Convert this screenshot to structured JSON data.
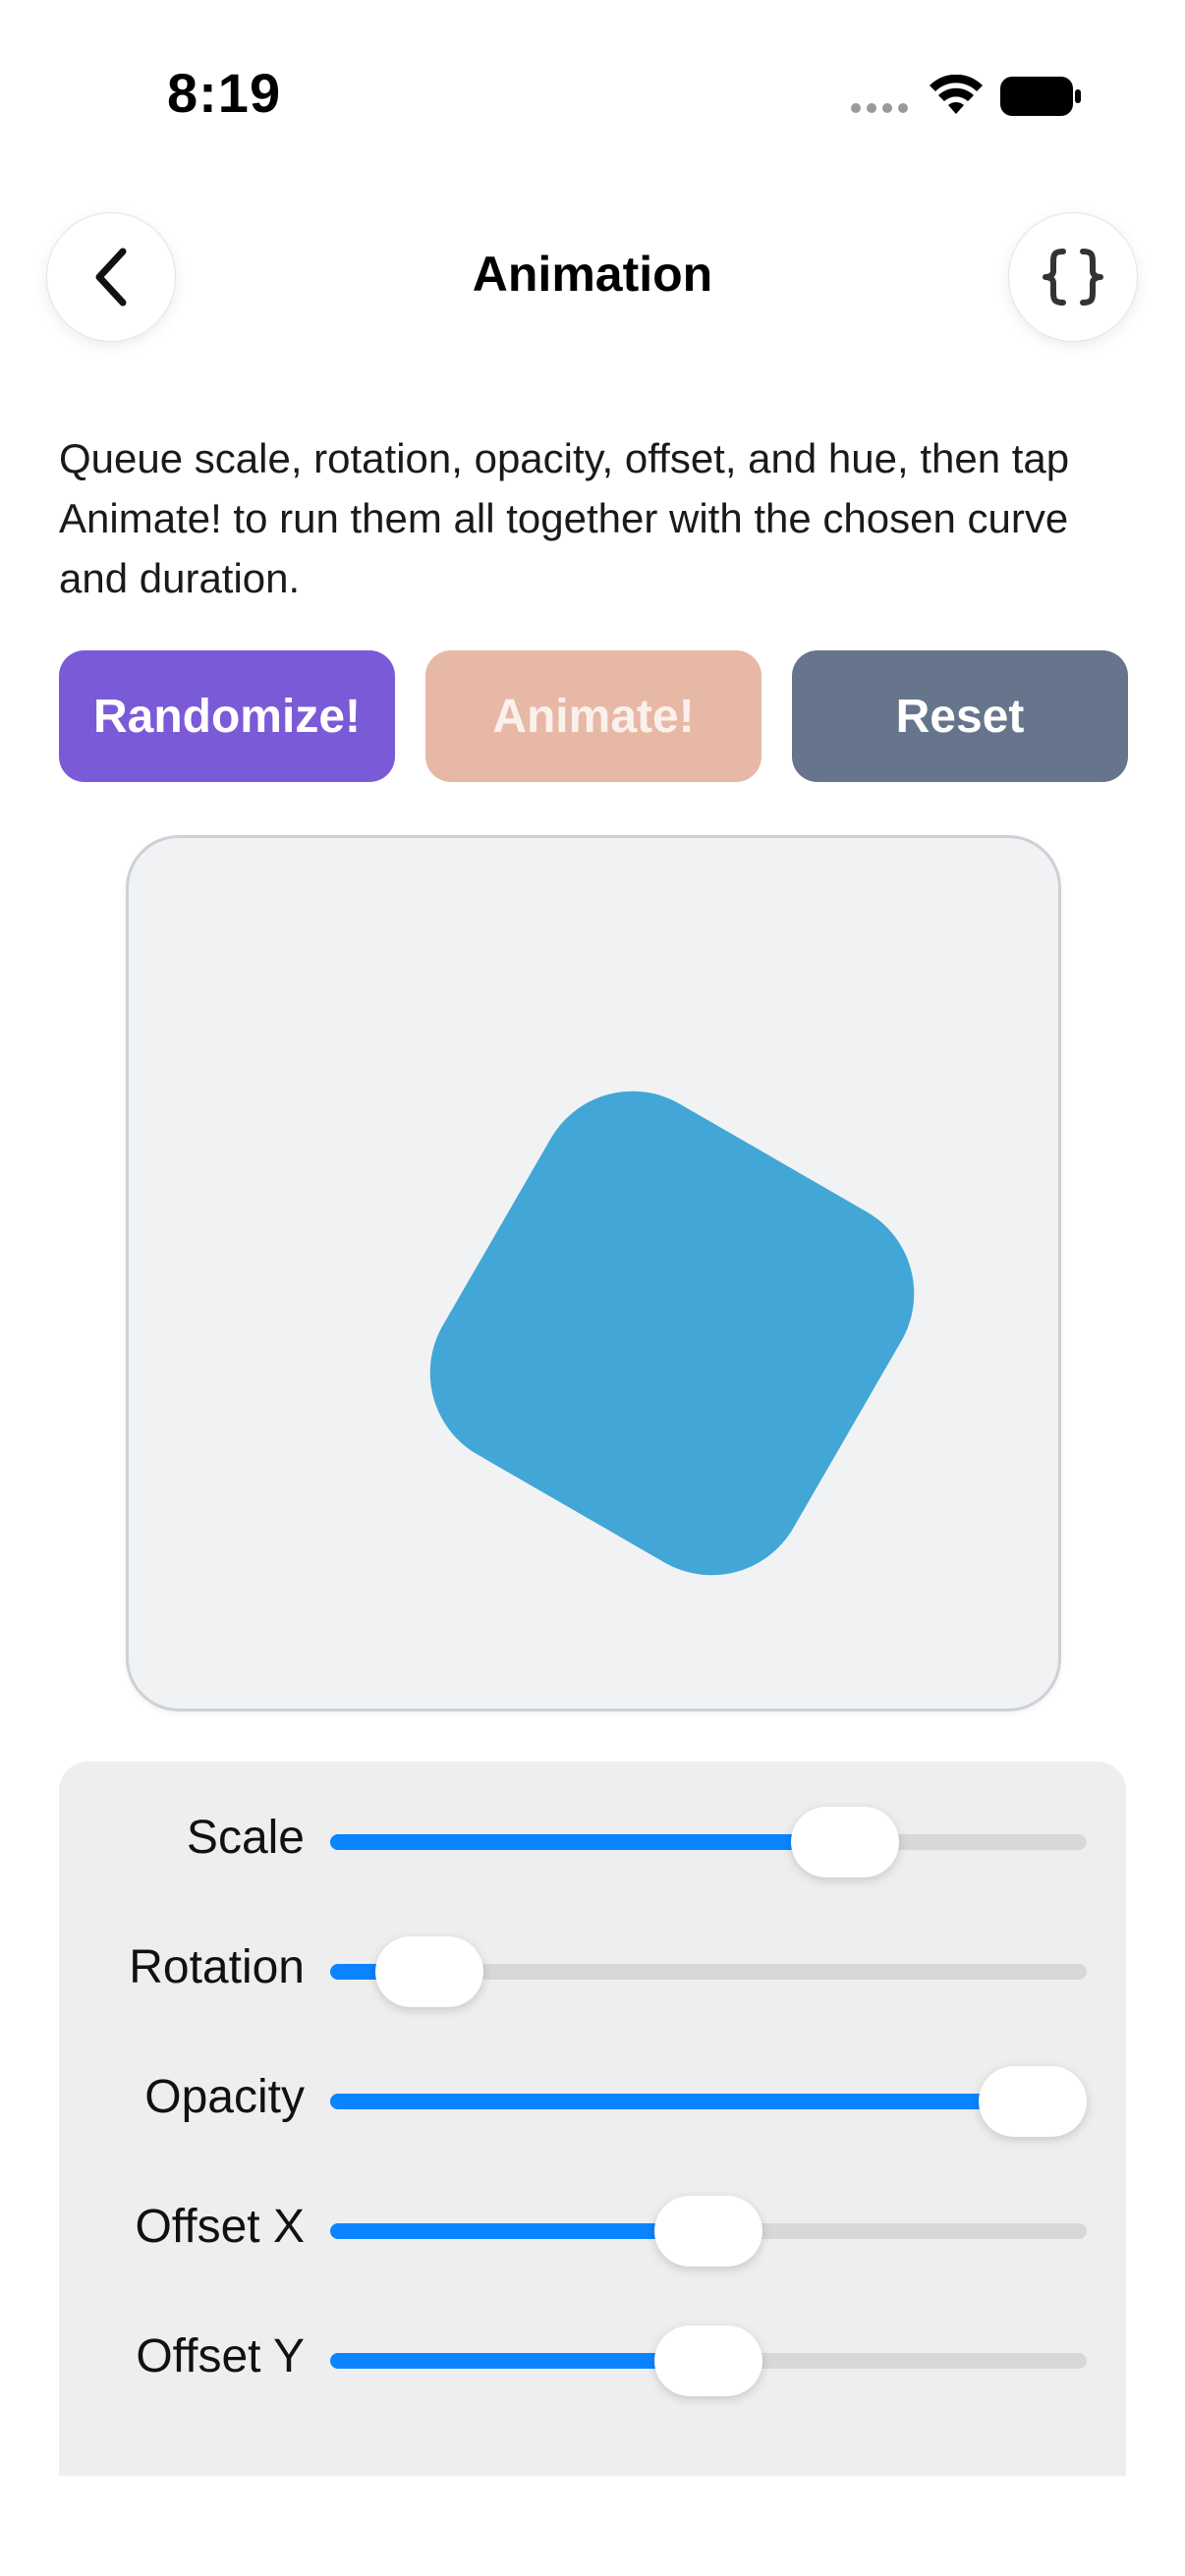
{
  "status_bar": {
    "time": "8:19"
  },
  "nav": {
    "title": "Animation",
    "back_icon": "chevron-left-icon",
    "code_icon": "curly-braces-icon"
  },
  "description": "Queue scale, rotation, opacity, offset, and hue, then tap Animate! to run them all together with the chosen curve and duration.",
  "actions": {
    "randomize_label": "Randomize!",
    "animate_label": "Animate!",
    "reset_label": "Reset"
  },
  "colors": {
    "randomize": "#7b5ad8",
    "animate": "#e8b8a6",
    "reset": "#66758c",
    "shape": "#42a6d7",
    "slider_fill": "#0a84ff"
  },
  "preview": {
    "shape_rotation_deg": 30
  },
  "controls": [
    {
      "label": "Scale",
      "value": 0.71
    },
    {
      "label": "Rotation",
      "value": 0.07
    },
    {
      "label": "Opacity",
      "value": 1.0
    },
    {
      "label": "Offset X",
      "value": 0.5
    },
    {
      "label": "Offset Y",
      "value": 0.5
    }
  ]
}
